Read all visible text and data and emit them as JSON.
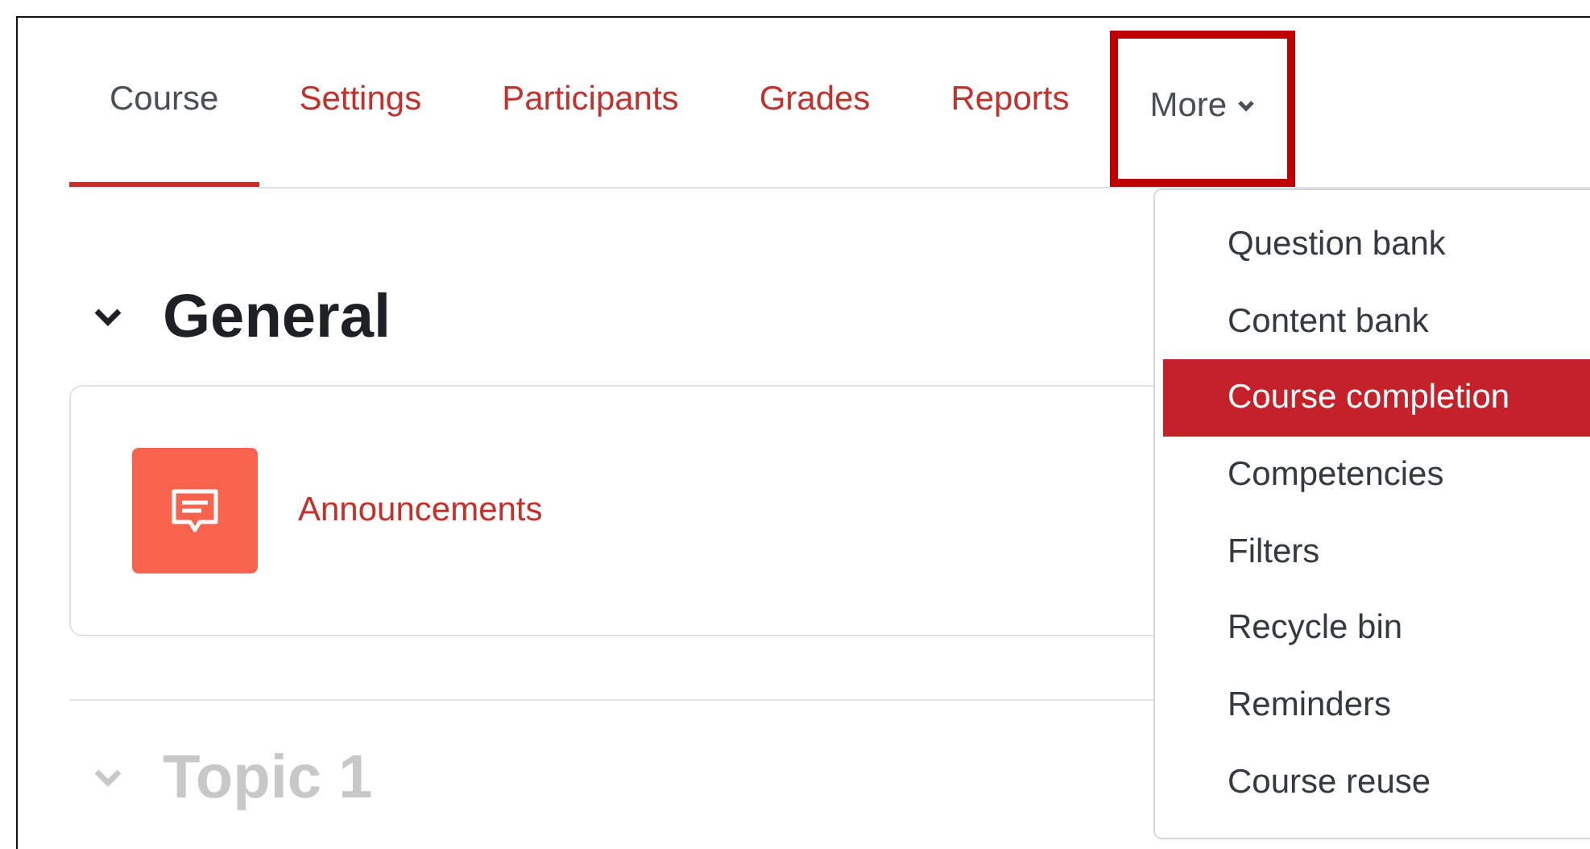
{
  "tabs": [
    {
      "label": "Course",
      "selected": true,
      "highlighted": false,
      "dropdown": false
    },
    {
      "label": "Settings",
      "selected": false,
      "highlighted": false,
      "dropdown": false
    },
    {
      "label": "Participants",
      "selected": false,
      "highlighted": false,
      "dropdown": false
    },
    {
      "label": "Grades",
      "selected": false,
      "highlighted": false,
      "dropdown": false
    },
    {
      "label": "Reports",
      "selected": false,
      "highlighted": false,
      "dropdown": false
    },
    {
      "label": "More",
      "selected": false,
      "highlighted": true,
      "dropdown": true
    }
  ],
  "more_menu": {
    "items": [
      {
        "label": "Question bank",
        "selected": false
      },
      {
        "label": "Content bank",
        "selected": false
      },
      {
        "label": "Course completion",
        "selected": true
      },
      {
        "label": "Competencies",
        "selected": false
      },
      {
        "label": "Filters",
        "selected": false
      },
      {
        "label": "Recycle bin",
        "selected": false
      },
      {
        "label": "Reminders",
        "selected": false
      },
      {
        "label": "Course reuse",
        "selected": false
      }
    ]
  },
  "sections": [
    {
      "title": "General",
      "expanded": true,
      "activities": [
        {
          "kind": "forum",
          "name": "Announcements"
        }
      ]
    },
    {
      "title": "Topic 1",
      "expanded": true
    }
  ]
}
